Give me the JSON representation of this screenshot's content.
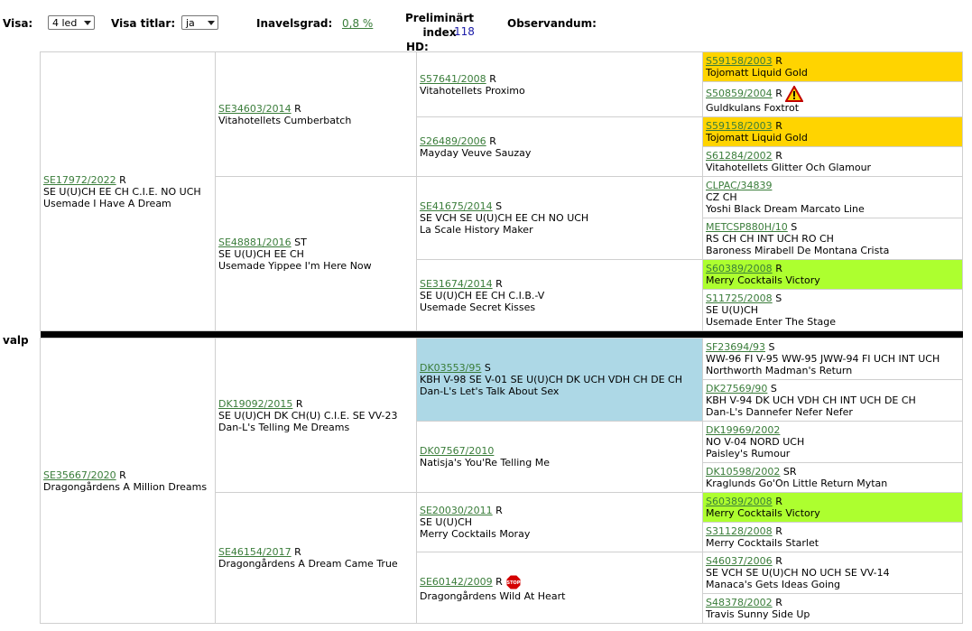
{
  "header": {
    "visa_label": "Visa:",
    "visa_value": "4 led",
    "titlar_label": "Visa titlar:",
    "titlar_value": "ja",
    "inavel_label": "Inavelsgrad:",
    "inavel_value": "0,8 %",
    "index_label_1": "Preliminärt index",
    "index_label_2": "HD:",
    "index_value": "118",
    "observandum_label": "Observandum:"
  },
  "puppy_label": "valp",
  "colors": {
    "highlight_yellow": "#ffd400",
    "highlight_green": "#adff2f",
    "highlight_blue": "#add8e6",
    "link": "#3a7d3a"
  },
  "pedigree": {
    "sire": {
      "reg": "SE17972/2022",
      "code": "R",
      "titles": "SE U(U)CH EE CH C.I.E. NO UCH",
      "name": "Usemade I Have A Dream"
    },
    "dam": {
      "reg": "SE35667/2020",
      "code": "R",
      "name": "Dragongårdens A Million Dreams"
    },
    "g2": [
      {
        "reg": "SE34603/2014",
        "code": "R",
        "titles": "",
        "name": "Vitahotellets Cumberbatch"
      },
      {
        "reg": "SE48881/2016",
        "code": "ST",
        "titles": "SE U(U)CH EE CH",
        "name": "Usemade Yippee I'm Here Now"
      },
      {
        "reg": "DK19092/2015",
        "code": "R",
        "titles": "SE U(U)CH DK CH(U) C.I.E. SE VV-23",
        "name": "Dan-L's Telling Me Dreams"
      },
      {
        "reg": "SE46154/2017",
        "code": "R",
        "titles": "",
        "name": "Dragongårdens A Dream Came True"
      }
    ],
    "g3": [
      {
        "reg": "S57641/2008",
        "code": "R",
        "titles": "",
        "name": "Vitahotellets Proximo"
      },
      {
        "reg": "S26489/2006",
        "code": "R",
        "titles": "",
        "name": "Mayday Veuve Sauzay"
      },
      {
        "reg": "SE41675/2014",
        "code": "S",
        "titles": "SE VCH SE U(U)CH EE CH NO UCH",
        "name": "La Scale History Maker"
      },
      {
        "reg": "SE31674/2014",
        "code": "R",
        "titles": "SE U(U)CH EE CH C.I.B.-V",
        "name": "Usemade Secret Kisses"
      },
      {
        "reg": "DK03553/95",
        "code": "S",
        "titles": "KBH V-98 SE V-01 SE U(U)CH DK UCH VDH CH DE CH",
        "name": "Dan-L's Let's Talk About Sex"
      },
      {
        "reg": "DK07567/2010",
        "code": "",
        "titles": "",
        "name": "Natisja's You'Re Telling Me"
      },
      {
        "reg": "SE20030/2011",
        "code": "R",
        "titles": "SE U(U)CH",
        "name": "Merry Cocktails Moray"
      },
      {
        "reg": "SE60142/2009",
        "code": "R",
        "titles": "",
        "name": "Dragongårdens Wild At Heart",
        "icon": "stop-sign-icon"
      }
    ],
    "g4": [
      {
        "reg": "S59158/2003",
        "code": "R",
        "titles": "",
        "name": "Tojomatt Liquid Gold"
      },
      {
        "reg": "S50859/2004",
        "code": "R",
        "titles": "",
        "name": "Guldkulans Foxtrot",
        "icon": "warning-icon"
      },
      {
        "reg": "S59158/2003",
        "code": "R",
        "titles": "",
        "name": "Tojomatt Liquid Gold"
      },
      {
        "reg": "S61284/2002",
        "code": "R",
        "titles": "",
        "name": "Vitahotellets Glitter Och Glamour"
      },
      {
        "reg": "CLPAC/34839",
        "code": "",
        "titles": "CZ CH",
        "name": "Yoshi Black Dream Marcato Line"
      },
      {
        "reg": "METCSP880H/10",
        "code": "S",
        "titles": "RS CH CH INT UCH RO CH",
        "name": "Baroness Mirabell De Montana Crista"
      },
      {
        "reg": "S60389/2008",
        "code": "R",
        "titles": "",
        "name": "Merry Cocktails Victory"
      },
      {
        "reg": "S11725/2008",
        "code": "S",
        "titles": "SE U(U)CH",
        "name": "Usemade Enter The Stage"
      },
      {
        "reg": "SF23694/93",
        "code": "S",
        "titles": "WW-96 FI V-95 WW-95 JWW-94 FI UCH INT UCH",
        "name": "Northworth Madman's Return"
      },
      {
        "reg": "DK27569/90",
        "code": "S",
        "titles": "KBH V-94 DK UCH VDH CH INT UCH DE CH",
        "name": "Dan-L's Dannefer Nefer Nefer"
      },
      {
        "reg": "DK19969/2002",
        "code": "",
        "titles": "NO V-04 NORD UCH",
        "name": "Paisley's Rumour"
      },
      {
        "reg": "DK10598/2002",
        "code": "SR",
        "titles": "",
        "name": "Kraglunds Go'On Little Return Mytan"
      },
      {
        "reg": "S60389/2008",
        "code": "R",
        "titles": "",
        "name": "Merry Cocktails Victory"
      },
      {
        "reg": "S31128/2008",
        "code": "R",
        "titles": "",
        "name": "Merry Cocktails Starlet"
      },
      {
        "reg": "S46037/2006",
        "code": "R",
        "titles": "SE VCH SE U(U)CH NO UCH SE VV-14",
        "name": "Manaca's Gets Ideas Going"
      },
      {
        "reg": "S48378/2002",
        "code": "R",
        "titles": "",
        "name": "Travis Sunny Side Up"
      }
    ]
  }
}
